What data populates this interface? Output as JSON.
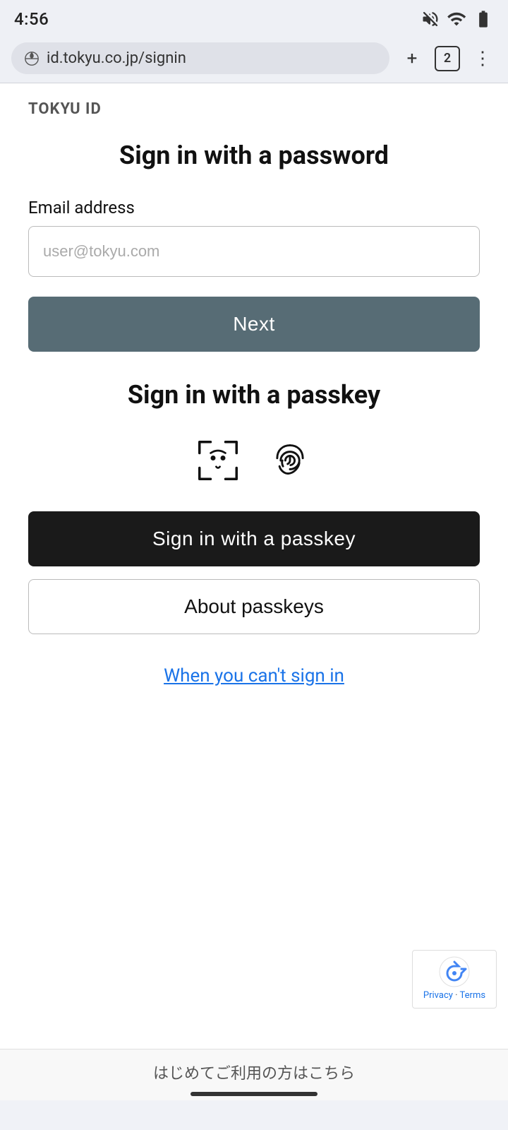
{
  "statusBar": {
    "time": "4:56",
    "tabIcon": "tab-icon",
    "muteIcon": "mute-icon",
    "wifiIcon": "wifi-icon",
    "batteryIcon": "battery-icon"
  },
  "browserBar": {
    "urlIcon": "url-icon",
    "url": "id.tokyu.co.jp/signin",
    "addTabLabel": "+",
    "tabCount": "2",
    "menuIcon": "⋮"
  },
  "page": {
    "brandTitle": "TOKYU ID",
    "passwordSection": {
      "heading": "Sign in with a password",
      "emailLabel": "Email address",
      "emailPlaceholder": "user@tokyu.com",
      "nextButton": "Next"
    },
    "passkeySection": {
      "heading": "Sign in with a passkey",
      "faceScanIconName": "face-scan-icon",
      "fingerprintIconName": "fingerprint-icon",
      "signInPasskeyButton": "Sign in with a passkey",
      "aboutPasskeysButton": "About passkeys"
    },
    "cantSignInLink": "When you can't sign in",
    "recaptcha": {
      "privacyText": "Privacy",
      "termsText": "Terms",
      "separator": "·"
    },
    "footer": {
      "text": "はじめてご利用の方はこちら"
    }
  }
}
